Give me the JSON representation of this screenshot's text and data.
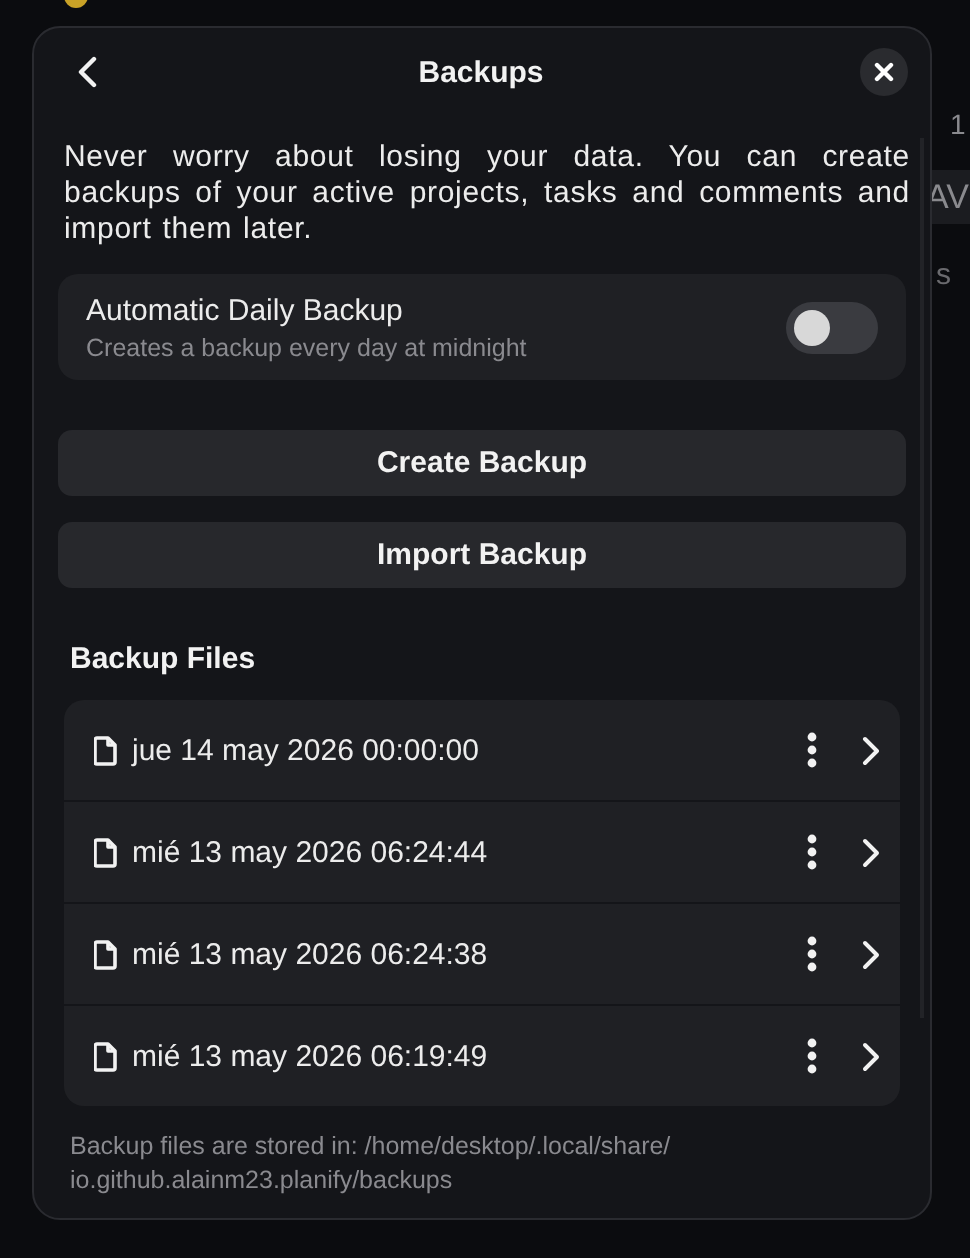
{
  "background": {
    "items": [
      "1",
      "AV",
      "s"
    ]
  },
  "dialog": {
    "title": "Backups",
    "description": "Never worry about losing your data. You can create backups of your active projects, tasks and comments and import them later.",
    "automatic_backup": {
      "title": "Automatic Daily Backup",
      "subtitle": "Creates a backup every day at midnight",
      "on": false
    },
    "buttons": [
      "Create Backup",
      "Import Backup"
    ],
    "files_heading": "Backup Files",
    "files": [
      {
        "name": "jue 14 may 2026 00:00:00"
      },
      {
        "name": "mié 13 may 2026 06:24:44"
      },
      {
        "name": "mié 13 may 2026 06:24:38"
      },
      {
        "name": "mié 13 may 2026 06:19:49"
      }
    ],
    "footer": "Backup files are stored in: /home/desktop/.local/share/ io.github.alainm23.planify/backups"
  }
}
